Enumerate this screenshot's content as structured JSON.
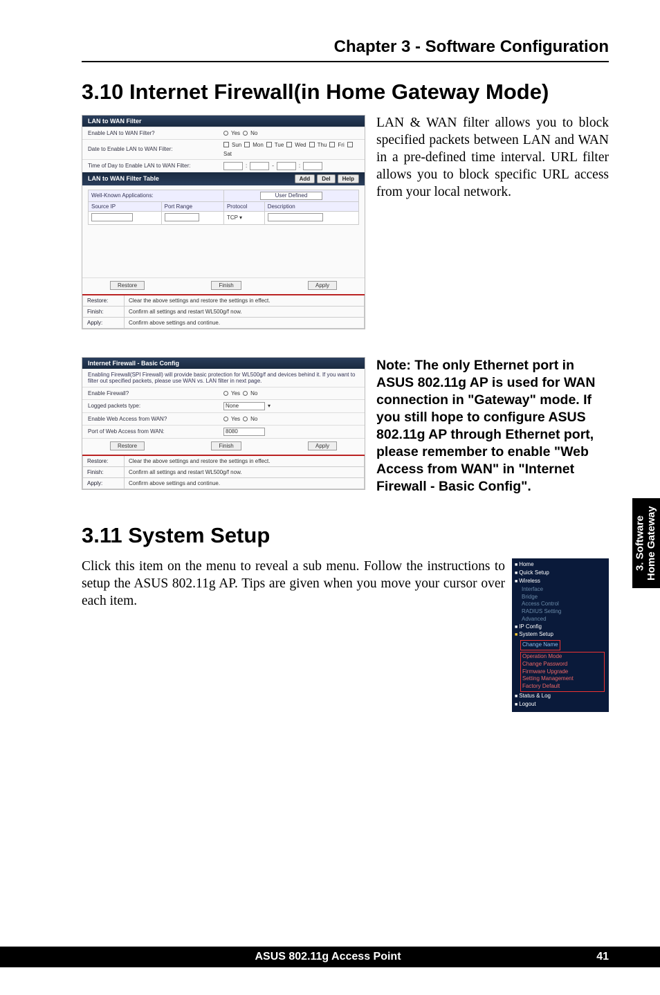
{
  "chapter_header": "Chapter 3 - Software Configuration",
  "section_3_10_title": "3.10  Internet Firewall(in Home Gateway Mode)",
  "lan_wan_panel": {
    "title": "LAN to WAN Filter",
    "rows": {
      "enable": {
        "label": "Enable LAN to WAN Filter?",
        "opts": [
          "Yes",
          "No"
        ]
      },
      "date": {
        "label": "Date to Enable LAN to WAN Filter:",
        "opts": [
          "Sun",
          "Mon",
          "Tue",
          "Wed",
          "Thu",
          "Fri",
          "Sat"
        ]
      },
      "time": {
        "label": "Time of Day to Enable LAN to WAN Filter:"
      }
    },
    "table_bar": "LAN to WAN Filter Table",
    "table_btns": [
      "Add",
      "Del",
      "Help"
    ],
    "th": [
      "Well-Known Applications:",
      "User Defined"
    ],
    "cols": [
      "Source IP",
      "Port Range",
      "Protocol",
      "Description"
    ],
    "proto": "TCP",
    "btns": [
      "Restore",
      "Finish",
      "Apply"
    ],
    "desc": {
      "restore": {
        "k": "Restore:",
        "v": "Clear the above settings and restore the settings in effect."
      },
      "finish": {
        "k": "Finish:",
        "v": "Confirm all settings and restart WL500g/f now."
      },
      "apply": {
        "k": "Apply:",
        "v": "Confirm above settings and continue."
      }
    }
  },
  "para_lan_wan": "LAN & WAN filter allows you to block specified packets between LAN and WAN in a pre-defined time interval. URL filter allows you to block specific URL access from your local network.",
  "firewall_panel": {
    "title": "Internet Firewall - Basic Config",
    "intro": "Enabling Firewall(SPI Firewall) will provide basic protection for WL500g/f and devices behind it. If you want to filter out specified packets, please use WAN vs. LAN filter in next page.",
    "rows": {
      "enable": {
        "label": "Enable Firewall?",
        "opts": [
          "Yes",
          "No"
        ]
      },
      "logged": {
        "label": "Logged packets type:",
        "val": "None"
      },
      "webwan": {
        "label": "Enable Web Access from WAN?",
        "opts": [
          "Yes",
          "No"
        ]
      },
      "port": {
        "label": "Port of Web Access from WAN:",
        "val": "8080"
      }
    },
    "btns": [
      "Restore",
      "Finish",
      "Apply"
    ],
    "desc": {
      "restore": {
        "k": "Restore:",
        "v": "Clear the above settings and restore the settings in effect."
      },
      "finish": {
        "k": "Finish:",
        "v": "Confirm all settings and restart WL500g/f now."
      },
      "apply": {
        "k": "Apply:",
        "v": "Confirm above settings and continue."
      }
    }
  },
  "note_text": "Note: The only Ethernet port in ASUS 802.11g AP is used for WAN connection in \"Gateway\" mode. If you still hope to config­ure ASUS 802.11g AP through Ethernet port, please remember to enable \"Web Access from WAN\" in \"Internet Firewall - Ba­sic Config\".",
  "section_3_11_title": "3.11  System Setup",
  "para_3_11": "Click this item on the menu to reveal a sub menu. Follow the instructions to setup the ASUS 802.11g AP. Tips are given when you move your cursor over each item.",
  "menu": {
    "items": [
      {
        "cls": "bullet white whiteTxt",
        "text": "Home"
      },
      {
        "cls": "bullet white whiteTxt",
        "text": "Quick Setup"
      },
      {
        "cls": "bullet white whiteTxt",
        "text": "Wireless"
      },
      {
        "cls": "item",
        "text": "Interface"
      },
      {
        "cls": "item",
        "text": "Bridge"
      },
      {
        "cls": "item",
        "text": "Access Control"
      },
      {
        "cls": "item",
        "text": "RADIUS Setting"
      },
      {
        "cls": "item",
        "text": "Advanced"
      },
      {
        "cls": "bullet white whiteTxt",
        "text": "IP Config"
      },
      {
        "cls": "bullet yellow whiteTxt",
        "text": "System Setup"
      },
      {
        "cls": "item red",
        "text": "Change Password"
      },
      {
        "cls": "item red",
        "text": "Firmware Upgrade"
      },
      {
        "cls": "item red",
        "text": "Setting Management"
      },
      {
        "cls": "item red",
        "text": "Factory Default"
      },
      {
        "cls": "bullet white whiteTxt",
        "text": "Status & Log"
      },
      {
        "cls": "bullet white whiteTxt",
        "text": "Logout"
      }
    ],
    "boxed_first": "Change Name",
    "boxed_items": [
      "Operation Mode"
    ]
  },
  "side_tab": {
    "l1": "3. Software",
    "l2": "Home Gateway"
  },
  "footer": {
    "title": "ASUS 802.11g Access Point",
    "page": "41"
  }
}
